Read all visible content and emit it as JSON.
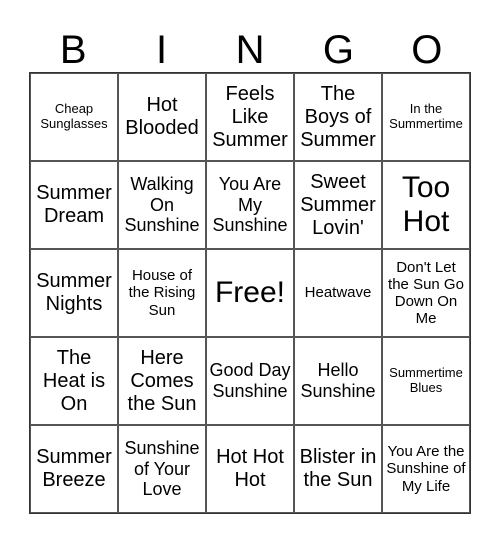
{
  "header": [
    "B",
    "I",
    "N",
    "G",
    "O"
  ],
  "cells": [
    "Cheap Sunglasses",
    "Hot Blooded",
    "Feels Like Summer",
    "The Boys of Summer",
    "In the Summertime",
    "Summer Dream",
    "Walking On Sunshine",
    "You Are My Sunshine",
    "Sweet Summer Lovin'",
    "Too Hot",
    "Summer Nights",
    "House of the Rising Sun",
    "Free!",
    "Heatwave",
    "Don't Let the Sun Go Down On Me",
    "The Heat is On",
    "Here Comes the Sun",
    "Good Day Sunshine",
    "Hello Sunshine",
    "Summertime Blues",
    "Summer Breeze",
    "Sunshine of Your Love",
    "Hot Hot Hot",
    "Blister in the Sun",
    "You Are the Sunshine of My Life"
  ]
}
